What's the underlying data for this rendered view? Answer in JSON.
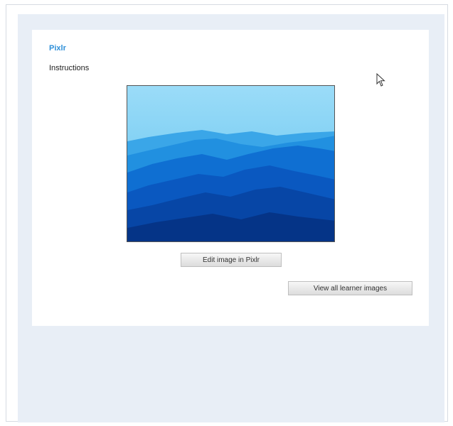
{
  "app": {
    "title": "Pixlr",
    "instructions": "Instructions"
  },
  "image": {
    "subject": "blue mountain ridges landscape",
    "colors": [
      "#93d8f7",
      "#3aa6e8",
      "#1f7fdc",
      "#0a5ec8",
      "#0746a6",
      "#053487"
    ]
  },
  "buttons": {
    "edit_label": "Edit image in Pixlr",
    "view_label": "View all learner images"
  },
  "colors": {
    "title": "#2e8fd8",
    "panel_bg": "#e8eef6",
    "card_bg": "#ffffff"
  }
}
